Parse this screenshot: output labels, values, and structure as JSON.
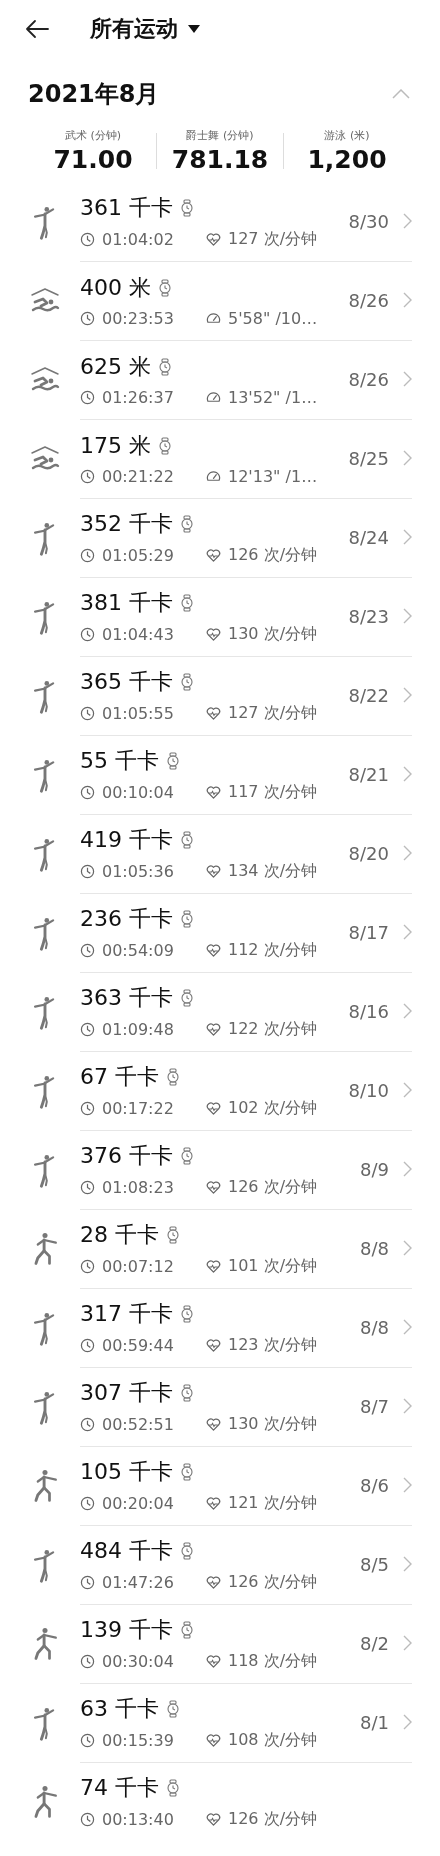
{
  "header": {
    "title": "所有运动"
  },
  "month": {
    "title": "2021年8月",
    "expanded": true
  },
  "stats": [
    {
      "label": "武术 (分钟)",
      "value": "71.00"
    },
    {
      "label": "爵士舞 (分钟)",
      "value": "781.18"
    },
    {
      "label": "游泳 (米)",
      "value": "1,200"
    }
  ],
  "records": [
    {
      "kind": "dance",
      "title": "361 千卡",
      "duration": "01:04:02",
      "metric": "127 次/分钟",
      "date": "8/30"
    },
    {
      "kind": "swim",
      "title": "400 米",
      "duration": "00:23:53",
      "metric": "5'58\" /10…",
      "date": "8/26"
    },
    {
      "kind": "swim",
      "title": "625 米",
      "duration": "01:26:37",
      "metric": "13'52\" /1…",
      "date": "8/26"
    },
    {
      "kind": "swim",
      "title": "175 米",
      "duration": "00:21:22",
      "metric": "12'13\" /1…",
      "date": "8/25"
    },
    {
      "kind": "dance",
      "title": "352 千卡",
      "duration": "01:05:29",
      "metric": "126 次/分钟",
      "date": "8/24"
    },
    {
      "kind": "dance",
      "title": "381 千卡",
      "duration": "01:04:43",
      "metric": "130 次/分钟",
      "date": "8/23"
    },
    {
      "kind": "dance",
      "title": "365 千卡",
      "duration": "01:05:55",
      "metric": "127 次/分钟",
      "date": "8/22"
    },
    {
      "kind": "dance",
      "title": "55 千卡",
      "duration": "00:10:04",
      "metric": "117 次/分钟",
      "date": "8/21"
    },
    {
      "kind": "dance",
      "title": "419 千卡",
      "duration": "01:05:36",
      "metric": "134 次/分钟",
      "date": "8/20"
    },
    {
      "kind": "dance",
      "title": "236 千卡",
      "duration": "00:54:09",
      "metric": "112 次/分钟",
      "date": "8/17"
    },
    {
      "kind": "dance",
      "title": "363 千卡",
      "duration": "01:09:48",
      "metric": "122 次/分钟",
      "date": "8/16"
    },
    {
      "kind": "dance",
      "title": "67 千卡",
      "duration": "00:17:22",
      "metric": "102 次/分钟",
      "date": "8/10"
    },
    {
      "kind": "dance",
      "title": "376 千卡",
      "duration": "01:08:23",
      "metric": "126 次/分钟",
      "date": "8/9"
    },
    {
      "kind": "martial",
      "title": "28 千卡",
      "duration": "00:07:12",
      "metric": "101 次/分钟",
      "date": "8/8"
    },
    {
      "kind": "dance",
      "title": "317 千卡",
      "duration": "00:59:44",
      "metric": "123 次/分钟",
      "date": "8/8"
    },
    {
      "kind": "dance",
      "title": "307 千卡",
      "duration": "00:52:51",
      "metric": "130 次/分钟",
      "date": "8/7"
    },
    {
      "kind": "martial",
      "title": "105 千卡",
      "duration": "00:20:04",
      "metric": "121 次/分钟",
      "date": "8/6"
    },
    {
      "kind": "dance",
      "title": "484 千卡",
      "duration": "01:47:26",
      "metric": "126 次/分钟",
      "date": "8/5"
    },
    {
      "kind": "martial",
      "title": "139 千卡",
      "duration": "00:30:04",
      "metric": "118 次/分钟",
      "date": "8/2"
    },
    {
      "kind": "dance",
      "title": "63 千卡",
      "duration": "00:15:39",
      "metric": "108 次/分钟",
      "date": "8/1"
    },
    {
      "kind": "martial",
      "title": "74 千卡",
      "duration": "00:13:40",
      "metric": "126 次/分钟"
    }
  ]
}
